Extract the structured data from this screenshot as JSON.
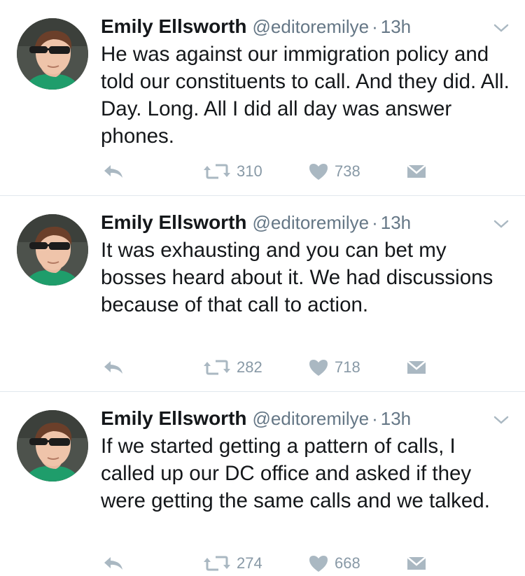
{
  "tweets": [
    {
      "name": "Emily Ellsworth",
      "handle": "@editoremilye",
      "separator": "·",
      "time": "13h",
      "text": "He was against our immigration policy and told our constituents to call. And they did. All. Day. Long. All I did all day was answer phones.",
      "retweets": "310",
      "likes": "738"
    },
    {
      "name": "Emily Ellsworth",
      "handle": "@editoremilye",
      "separator": "·",
      "time": "13h",
      "text": "It was exhausting and you can bet my bosses heard about it. We had discussions because of that call to action.",
      "retweets": "282",
      "likes": "718"
    },
    {
      "name": "Emily Ellsworth",
      "handle": "@editoremilye",
      "separator": "·",
      "time": "13h",
      "text": "If we started getting a pattern of calls, I called up our DC office and asked if they were getting the same calls and we talked.",
      "retweets": "274",
      "likes": "668"
    }
  ],
  "colors": {
    "text": "#14171a",
    "secondary": "#657786",
    "action_icon": "#aab8c2",
    "divider": "#e1e8ed",
    "avatar_shirt": "#1f9d6b"
  },
  "icons": [
    "avatar",
    "chevron-down-icon",
    "reply-icon",
    "retweet-icon",
    "heart-icon",
    "direct-message-icon"
  ]
}
